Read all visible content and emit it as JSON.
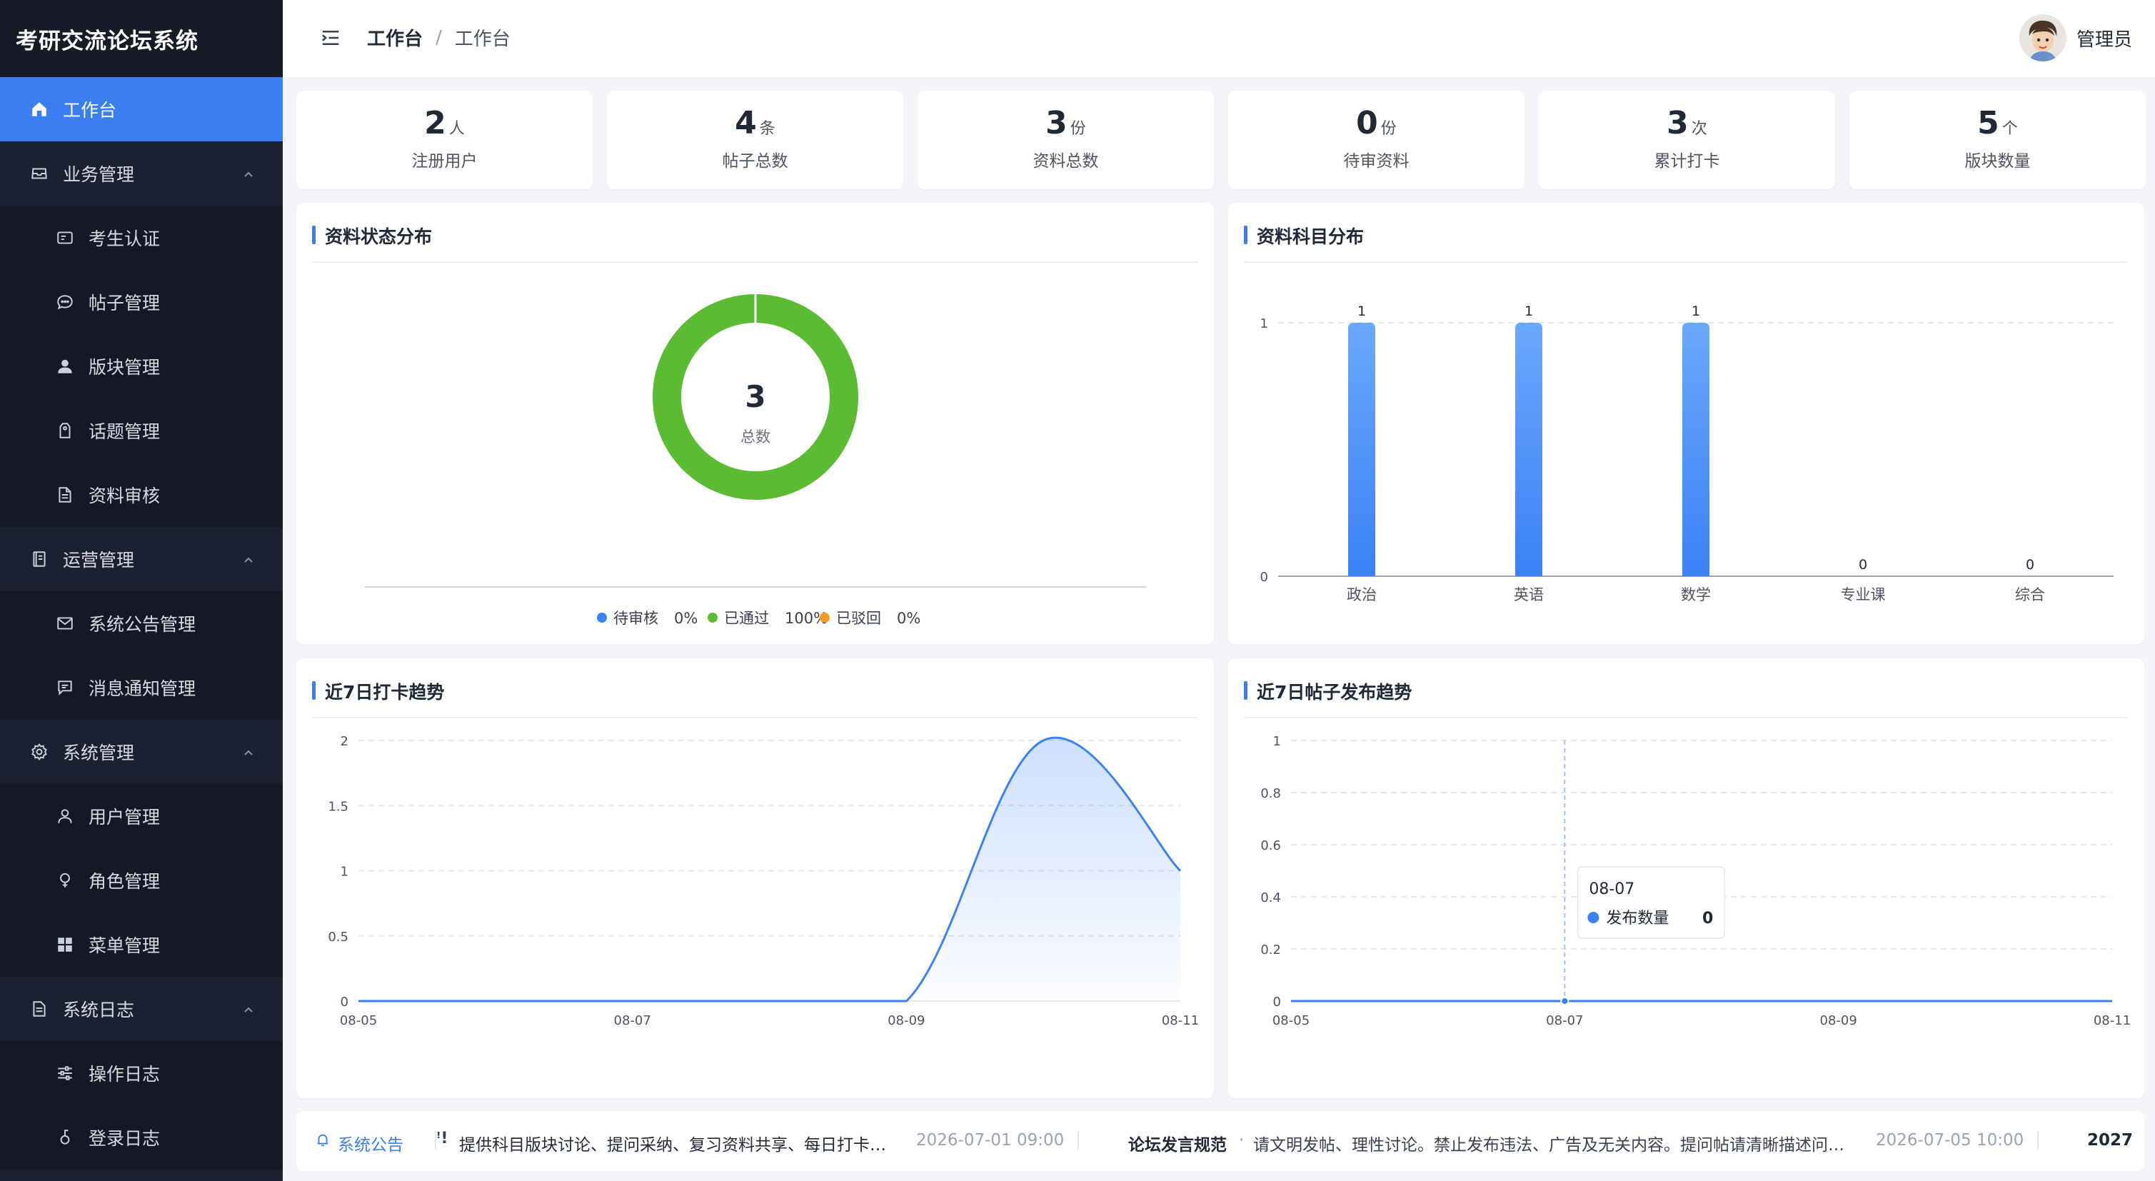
{
  "app": {
    "title": "考研交流论坛系统"
  },
  "sidebar": {
    "items": [
      {
        "label": "工作台",
        "icon": "home-icon",
        "active": true
      },
      {
        "label": "业务管理",
        "icon": "briefcase-icon"
      },
      {
        "label": "考生认证",
        "icon": "id-card-icon"
      },
      {
        "label": "帖子管理",
        "icon": "chat-bubble-icon"
      },
      {
        "label": "版块管理",
        "icon": "person-icon"
      },
      {
        "label": "话题管理",
        "icon": "tag-icon"
      },
      {
        "label": "资料审核",
        "icon": "document-icon"
      },
      {
        "label": "运营管理",
        "icon": "notebook-icon"
      },
      {
        "label": "系统公告管理",
        "icon": "mail-icon"
      },
      {
        "label": "消息通知管理",
        "icon": "message-icon"
      },
      {
        "label": "系统管理",
        "icon": "gear-icon"
      },
      {
        "label": "用户管理",
        "icon": "user-icon"
      },
      {
        "label": "角色管理",
        "icon": "bulb-icon"
      },
      {
        "label": "菜单管理",
        "icon": "grid-icon"
      },
      {
        "label": "系统日志",
        "icon": "log-icon"
      },
      {
        "label": "操作日志",
        "icon": "sliders-icon"
      },
      {
        "label": "登录日志",
        "icon": "lock-icon"
      }
    ]
  },
  "header": {
    "breadcrumb": [
      "工作台",
      "工作台"
    ],
    "separator": "/",
    "user": "管理员"
  },
  "stats": [
    {
      "value": "2",
      "unit": "人",
      "label": "注册用户"
    },
    {
      "value": "4",
      "unit": "条",
      "label": "帖子总数"
    },
    {
      "value": "3",
      "unit": "份",
      "label": "资料总数"
    },
    {
      "value": "0",
      "unit": "份",
      "label": "待审资料"
    },
    {
      "value": "3",
      "unit": "次",
      "label": "累计打卡"
    },
    {
      "value": "5",
      "unit": "个",
      "label": "版块数量"
    }
  ],
  "panels": {
    "status": "资料状态分布",
    "subject": "资料科目分布",
    "checkin": "近7日打卡趋势",
    "posts": "近7日帖子发布趋势"
  },
  "chart_data": [
    {
      "type": "pie",
      "title": "资料状态分布",
      "center_value": "3",
      "center_label": "总数",
      "slices": [
        {
          "label": "待审核",
          "value": 0,
          "percent": "0%",
          "color": "#3b82f6"
        },
        {
          "label": "已通过",
          "value": 3,
          "percent": "100%",
          "color": "#5bbb33"
        },
        {
          "label": "已驳回",
          "value": 0,
          "percent": "0%",
          "color": "#f59a23"
        }
      ]
    },
    {
      "type": "bar",
      "title": "资料科目分布",
      "categories": [
        "政治",
        "英语",
        "数学",
        "专业课",
        "综合"
      ],
      "values": [
        1,
        1,
        1,
        0,
        0
      ],
      "yticks": [
        "0",
        "1"
      ],
      "ylim": [
        0,
        1
      ],
      "color": "#4a90f7"
    },
    {
      "type": "area",
      "title": "近7日打卡趋势",
      "x": [
        "08-05",
        "08-06",
        "08-07",
        "08-08",
        "08-09",
        "08-10",
        "08-11"
      ],
      "xticks": [
        "08-05",
        "08-07",
        "08-09",
        "08-11"
      ],
      "values": [
        0,
        0,
        0,
        0,
        0,
        2,
        1
      ],
      "yticks": [
        "0",
        "0.5",
        "1",
        "1.5",
        "2"
      ],
      "ylim": [
        0,
        2
      ],
      "color": "#3b82f6"
    },
    {
      "type": "line",
      "title": "近7日帖子发布趋势",
      "x": [
        "08-05",
        "08-06",
        "08-07",
        "08-08",
        "08-09",
        "08-10",
        "08-11"
      ],
      "xticks": [
        "08-05",
        "08-07",
        "08-09",
        "08-11"
      ],
      "values": [
        0,
        0,
        0,
        0,
        0,
        0,
        0
      ],
      "yticks": [
        "0",
        "0.2",
        "0.4",
        "0.6",
        "0.8",
        "1"
      ],
      "ylim": [
        0,
        1
      ],
      "color": "#3b82f6",
      "tooltip": {
        "x": "08-07",
        "series": "发布数量",
        "value": "0"
      }
    }
  ],
  "notice": {
    "label": "系统公告",
    "item1_text": "提供科目版块讨论、提问采纳、复习资料共享、每日打卡…",
    "item1_date": "2026-07-01 09:00",
    "item2_title": "论坛发言规范",
    "item2_dot": "·",
    "item2_text": "请文明发帖、理性讨论。禁止发布违法、广告及无关内容。提问帖请清晰描述问…",
    "item2_date": "2026-07-05 10:00",
    "item3_title": "2027"
  },
  "colors": {
    "accent": "#3b7ef0",
    "sidebar_bg": "#1b2130",
    "success": "#5bbb33",
    "warning": "#f59a23"
  }
}
